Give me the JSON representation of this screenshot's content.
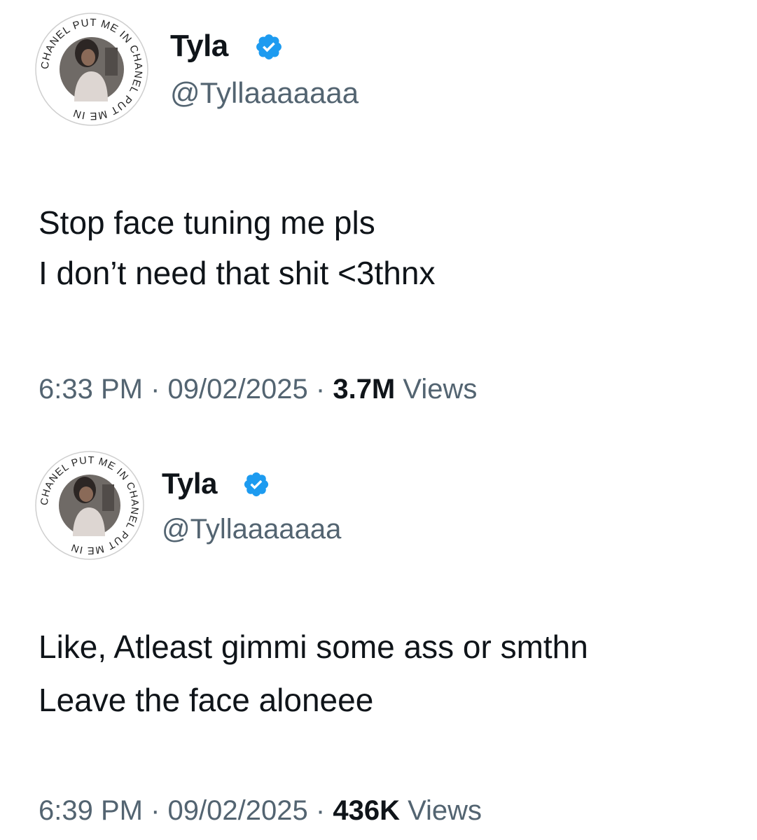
{
  "colors": {
    "text": "#0f1419",
    "secondary": "#536471",
    "verified": "#1d9bf0"
  },
  "tweets": [
    {
      "author": {
        "name": "Tyla",
        "handle": "@Tyllaaaaaaa",
        "verified_icon": "verified-badge-icon",
        "avatar_ring_text": "CHANEL PUT ME IN CHANEL PUT ME IN"
      },
      "text_lines": [
        "Stop face tuning me pls",
        "I don’t need that shit <3thnx"
      ],
      "time": "6:33 PM",
      "date": "09/02/2025",
      "views_count": "3.7M",
      "views_label": "Views",
      "separator": "·"
    },
    {
      "author": {
        "name": "Tyla",
        "handle": "@Tyllaaaaaaa",
        "verified_icon": "verified-badge-icon",
        "avatar_ring_text": "CHANEL PUT ME IN CHANEL PUT ME IN"
      },
      "text_lines": [
        "Like, Atleast gimmi some ass or smthn",
        "Leave the face aloneee"
      ],
      "time": "6:39 PM",
      "date": "09/02/2025",
      "views_count": "436K",
      "views_label": "Views",
      "separator": "·"
    }
  ]
}
